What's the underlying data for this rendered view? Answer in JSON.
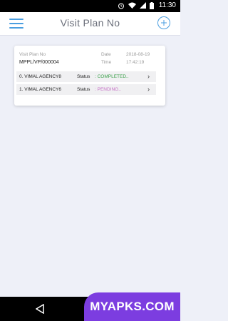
{
  "status_bar": {
    "time": "11:30"
  },
  "header": {
    "title": "Visit Plan No"
  },
  "card": {
    "plan_label": "Visit Plan No",
    "plan_value": "MPPL/VP/000004",
    "date_label": "Date",
    "date_value": "2018-08-19",
    "time_label": "Time",
    "time_value": "17:42:19",
    "rows": [
      {
        "agency": "0. VIMAL AGENCY8",
        "status_label": "Status",
        "status_value": ": COMPLETED..",
        "chevron": "›"
      },
      {
        "agency": "1. VIMAL AGENCY6",
        "status_label": "Status",
        "status_value": ": PENDING..",
        "chevron": "›"
      }
    ]
  },
  "colors": {
    "accent": "#4a9ee0",
    "completed": "#3aa04a",
    "pending": "#c56fc5",
    "watermark": "#7c3de0"
  },
  "icons": [
    "alarm-icon",
    "wifi-icon",
    "signal-icon",
    "battery-icon",
    "menu-icon",
    "add-icon",
    "chevron-right-icon",
    "back-icon",
    "home-icon"
  ],
  "watermark": {
    "text": "MYAPKS.COM"
  }
}
